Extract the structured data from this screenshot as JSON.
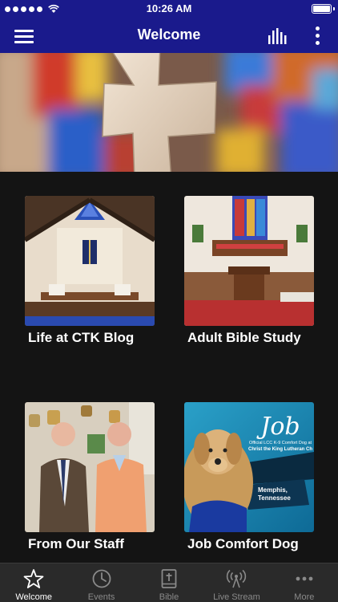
{
  "status_bar": {
    "time": "10:26 AM",
    "signal_dots": 5,
    "battery_level": 1.0
  },
  "nav": {
    "title": "Welcome",
    "menu_icon": "hamburger-menu-icon",
    "bars_icon": "equalizer-bars-icon",
    "more_icon": "more-vertical-icon"
  },
  "hero": {
    "image": "cross-stained-glass-photo"
  },
  "tiles": [
    {
      "label": "Life at CTK Blog",
      "image": "church-sanctuary-photo"
    },
    {
      "label": "Adult Bible Study",
      "image": "church-altar-photo"
    },
    {
      "label": "From Our Staff",
      "image": "staff-portrait-photo"
    },
    {
      "label": "Job Comfort Dog",
      "image": "comfort-dog-photo",
      "overlay": {
        "name": "Job",
        "subtitle_1": "Official LCC K-9 Comfort Dog at",
        "subtitle_2": "Christ the King Lutheran Ch",
        "city": "Memphis,",
        "state": "Tennessee"
      }
    }
  ],
  "tab_bar": {
    "tabs": [
      {
        "label": "Welcome",
        "icon": "star-icon",
        "active": true
      },
      {
        "label": "Events",
        "icon": "clock-icon",
        "active": false
      },
      {
        "label": "Bible",
        "icon": "bible-icon",
        "active": false
      },
      {
        "label": "Live Stream",
        "icon": "broadcast-icon",
        "active": false
      },
      {
        "label": "More",
        "icon": "more-horizontal-icon",
        "active": false
      }
    ]
  },
  "colors": {
    "nav_bg": "#1a1a8c",
    "page_bg": "#141414",
    "tab_bar_bg": "#2a2a2a",
    "tab_inactive": "#8a8a8a",
    "tab_active": "#ffffff"
  }
}
